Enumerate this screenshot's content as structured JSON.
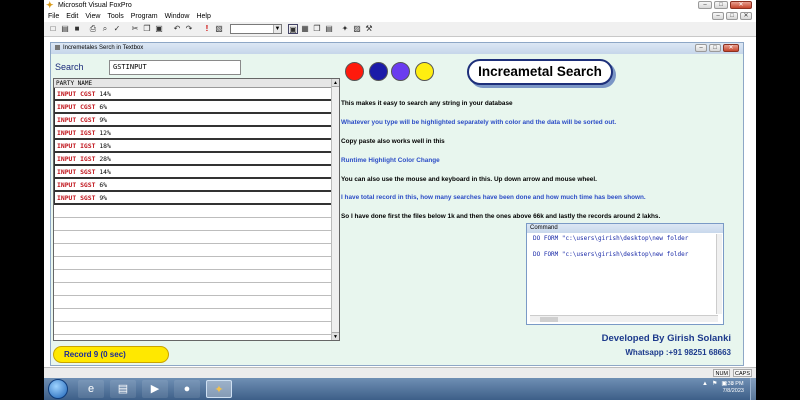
{
  "window": {
    "title": "Microsoft Visual FoxPro"
  },
  "menu": [
    "File",
    "Edit",
    "View",
    "Tools",
    "Program",
    "Window",
    "Help"
  ],
  "form": {
    "title": "Incremetales Serch in Textbox",
    "search_label": "Search",
    "search_value": "GSTINPUT",
    "grid": {
      "header": "PARTY NAME",
      "rows": [
        {
          "hl": "INPUT CGST",
          "rest": " 14%"
        },
        {
          "hl": "INPUT CGST",
          "rest": " 6%"
        },
        {
          "hl": "INPUT CGST",
          "rest": " 9%"
        },
        {
          "hl": "INPUT IGST",
          "rest": " 12%"
        },
        {
          "hl": "INPUT IGST",
          "rest": " 18%"
        },
        {
          "hl": "INPUT IGST",
          "rest": " 28%"
        },
        {
          "hl": "INPUT SGST",
          "rest": " 14%"
        },
        {
          "hl": "INPUT SGST",
          "rest": " 6%"
        },
        {
          "hl": "INPUT SGST",
          "rest": " 9%"
        }
      ]
    },
    "status": "Record  9 (0 sec)",
    "highlight_colors": [
      "#ff1a0c",
      "#1b1ba8",
      "#6a3cf0",
      "#ffee10"
    ],
    "heading": "Increametal Search",
    "info": [
      "This makes it easy to search  any string in your database",
      "Whatever you type will be highlighted separately with color and the data will be sorted out.",
      "Copy paste also works well in this",
      "Runtime Highlight Color Change",
      "You can also use the mouse and keyboard in this. Up down arrow and mouse wheel.",
      "I have total record in this, how many searches have been done and how much time has been shown.",
      "So I have done first the files below 1k and then the ones above 66k and lastly the records around 2 lakhs."
    ],
    "developer": "Developed By Girish Solanki",
    "whatsapp": "Whatsapp :+91 98251 68663"
  },
  "command_window": {
    "title": "Command",
    "lines": [
      "DO FORM \"c:\\users\\girish\\desktop\\new folder",
      "DO FORM \"c:\\users\\girish\\desktop\\new folder"
    ]
  },
  "statusbar": {
    "num": "NUM",
    "caps": "CAPS"
  },
  "taskbar": {
    "time": "6:38 PM",
    "date": "7/8/2023"
  }
}
